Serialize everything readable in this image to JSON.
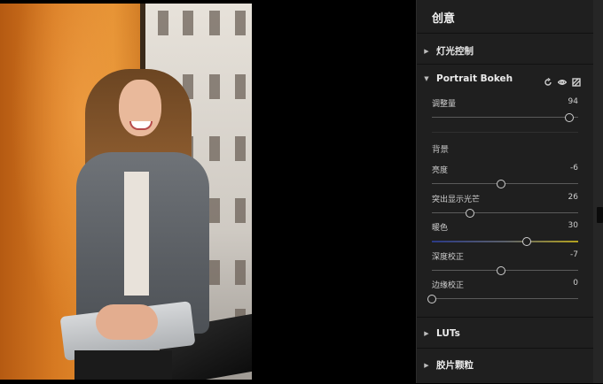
{
  "panel": {
    "title": "创意",
    "sections": [
      {
        "label": "灯光控制",
        "expanded": false
      },
      {
        "label": "Portrait Bokeh",
        "expanded": true
      },
      {
        "label": "LUTs",
        "expanded": false
      },
      {
        "label": "胶片颗粒",
        "expanded": false
      }
    ],
    "bokeh": {
      "amount": {
        "label": "调整量",
        "value": "94",
        "position": 0.94
      },
      "background_group_label": "背景",
      "sliders": [
        {
          "label": "亮度",
          "value": "-6",
          "position": 0.47
        },
        {
          "label": "突出显示光芒",
          "value": "26",
          "position": 0.26
        },
        {
          "label": "暖色",
          "value": "30",
          "position": 0.65
        },
        {
          "label": "深度校正",
          "value": "-7",
          "position": 0.47
        },
        {
          "label": "边缘校正",
          "value": "0",
          "position": 0.0
        }
      ]
    }
  },
  "icons": {
    "expanded": "triangle-down-icon",
    "collapsed": "triangle-right-icon",
    "reset": "reset-icon",
    "visibility": "eye-icon",
    "mask": "mask-icon"
  }
}
